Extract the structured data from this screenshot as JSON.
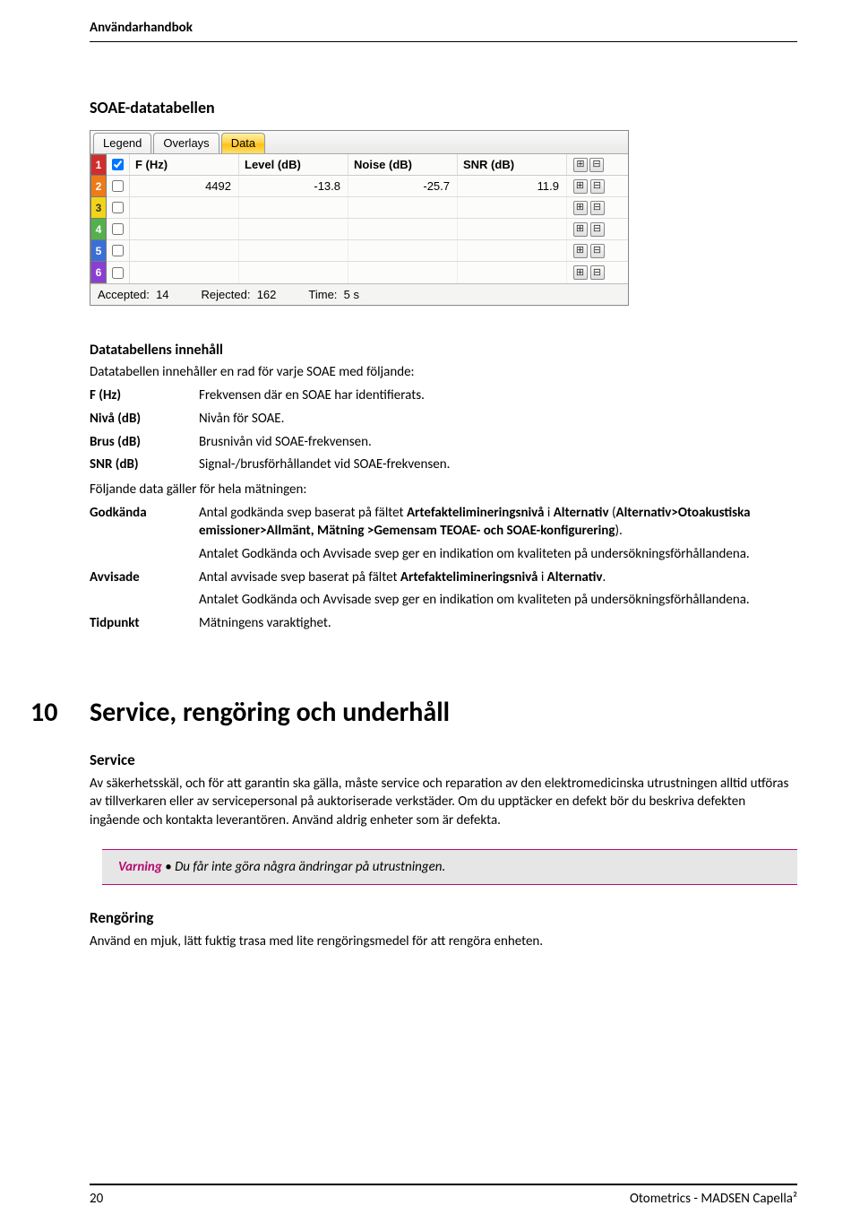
{
  "header": {
    "title": "Användarhandbok"
  },
  "section": {
    "title": "SOAE-datatabellen"
  },
  "widget": {
    "tabs": [
      "Legend",
      "Overlays",
      "Data"
    ],
    "activeTab": 2,
    "columns": [
      "F (Hz)",
      "Level (dB)",
      "Noise (dB)",
      "SNR (dB)"
    ],
    "rowColors": [
      "#d22d2d",
      "#ee7b1a",
      "#f2d418",
      "#54b04c",
      "#3a6fd8",
      "#8a3fd1"
    ],
    "data": {
      "fhz": "4492",
      "level": "-13.8",
      "noise": "-25.7",
      "snr": "11.9"
    },
    "footer": {
      "accepted_label": "Accepted:",
      "accepted_value": "14",
      "rejected_label": "Rejected:",
      "rejected_value": "162",
      "time_label": "Time:",
      "time_value": "5 s"
    }
  },
  "subsection": {
    "title": "Datatabellens innehåll",
    "intro": "Datatabellen innehåller en rad för varje SOAE med följande:"
  },
  "defs1": [
    {
      "label": "F  (Hz)",
      "value": "Frekvensen där en SOAE har identifierats."
    },
    {
      "label": "Nivå (dB)",
      "value": "Nivån för SOAE."
    },
    {
      "label": "Brus (dB)",
      "value": "Brusnivån vid SOAE-frekvensen."
    },
    {
      "label": "SNR (dB)",
      "value": "Signal-/brusförhållandet vid SOAE-frekvensen."
    }
  ],
  "midline": "Följande data gäller för hela mätningen:",
  "defs2": {
    "godkanda_label": "Godkända",
    "godkanda_p1a": "Antal godkända svep baserat på fältet ",
    "godkanda_p1b": "Artefaktelimineringsnivå",
    "godkanda_p1c": " i ",
    "godkanda_p1d": "Alternativ",
    "godkanda_p1e": " (",
    "godkanda_p1f": "Alternativ>Otoakustiska emissioner>Allmänt, Mätning >Gemensam TEOAE- och SOAE-konfigurering",
    "godkanda_p1g": ").",
    "godkanda_p2": "Antalet Godkända och Avvisade svep ger en indikation om kvaliteten på undersökningsförhållandena.",
    "avvisade_label": "Avvisade",
    "avvisade_p1a": "Antal avvisade svep baserat på fältet ",
    "avvisade_p1b": "Artefaktelimineringsnivå",
    "avvisade_p1c": " i ",
    "avvisade_p1d": "Alternativ",
    "avvisade_p1e": ".",
    "avvisade_p2": "Antalet Godkända och Avvisade svep ger en indikation om kvaliteten på undersökningsförhållandena.",
    "tidpunkt_label": "Tidpunkt",
    "tidpunkt_value": "Mätningens varaktighet."
  },
  "chapter": {
    "num": "10",
    "title": "Service, rengöring och underhåll"
  },
  "service": {
    "title": "Service",
    "para": "Av säkerhetsskäl, och för att garantin ska gälla, måste service och reparation av den elektromedicinska utrustningen alltid utföras av tillverkaren eller av servicepersonal på auktoriserade verkstäder. Om du upptäcker en defekt bör du beskriva defekten ingående och kontakta leverantören. Använd aldrig enheter som är defekta."
  },
  "warning": {
    "label": "Varning",
    "bullet": "•",
    "text": "Du får inte göra några ändringar på utrustningen."
  },
  "cleaning": {
    "title": "Rengöring",
    "para": "Använd en mjuk, lätt fuktig trasa med lite rengöringsmedel för att rengöra enheten."
  },
  "footer": {
    "page": "20",
    "product": "Otometrics - MADSEN Capella²"
  }
}
